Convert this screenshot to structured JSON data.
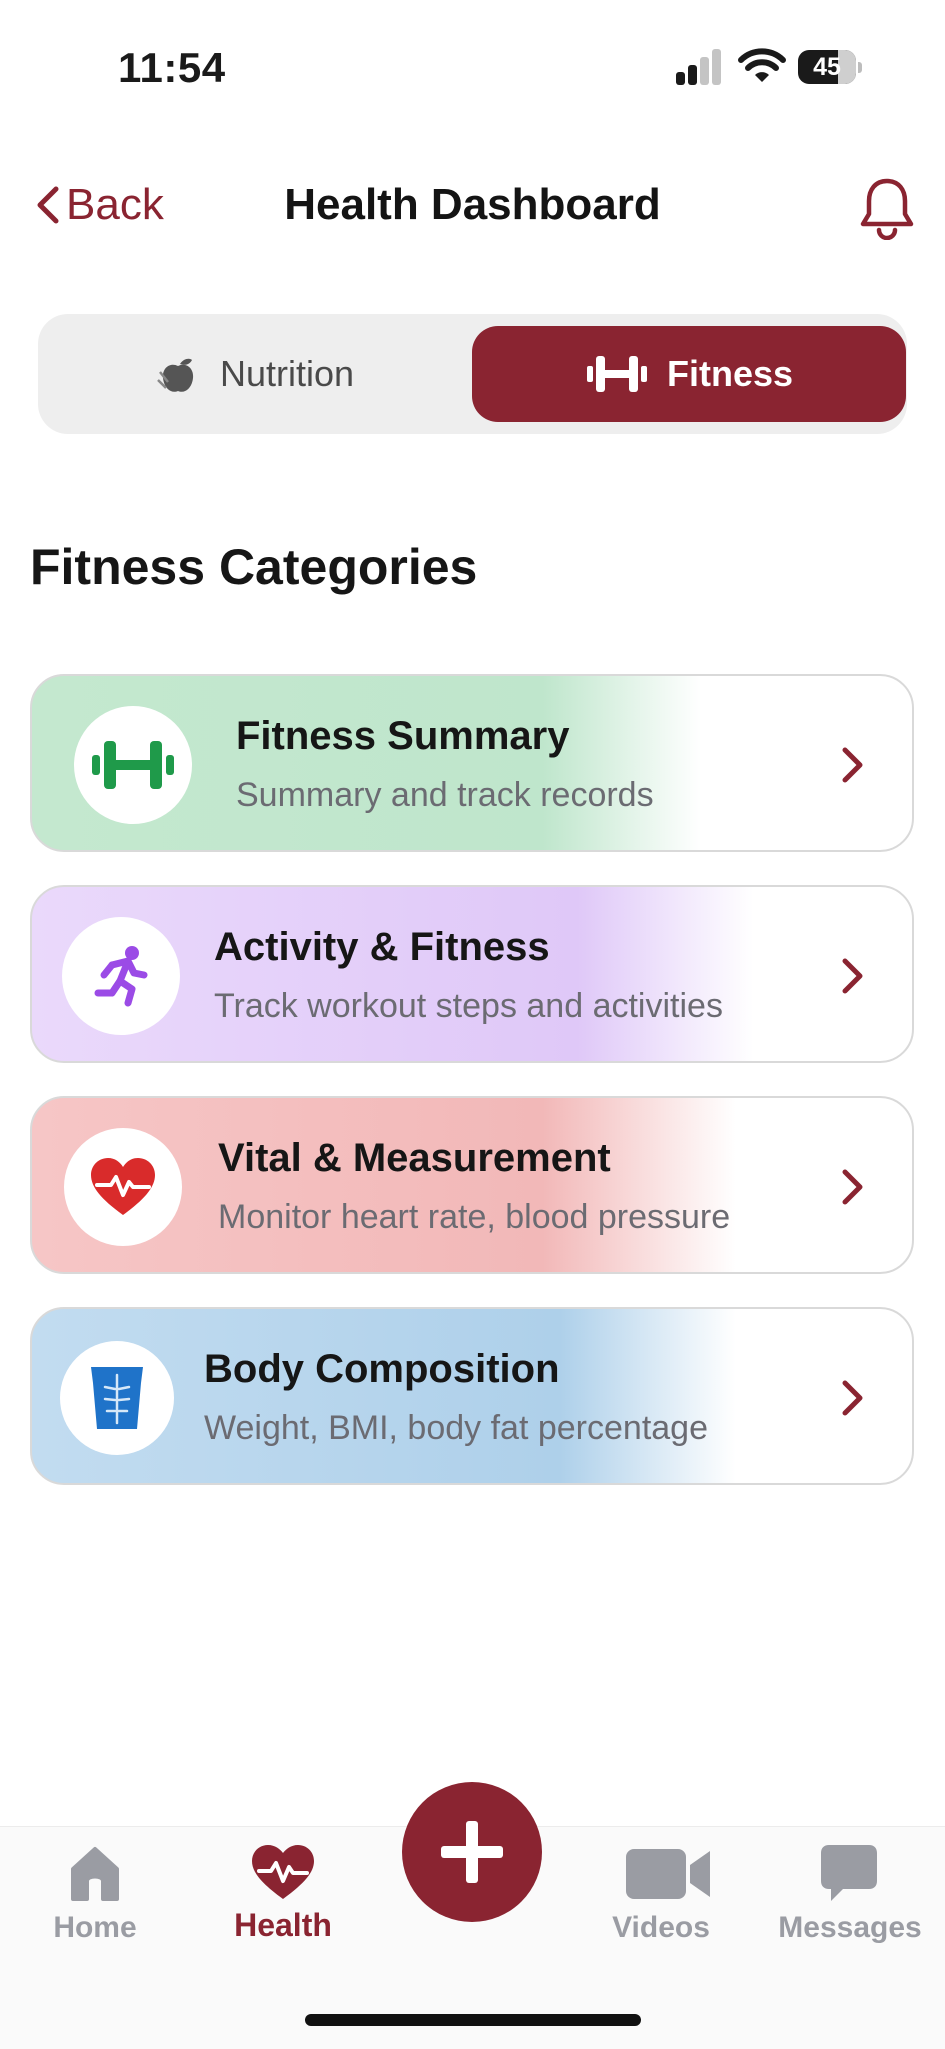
{
  "status_bar": {
    "time": "11:54",
    "battery": "45"
  },
  "header": {
    "back_label": "Back",
    "title": "Health Dashboard"
  },
  "segments": {
    "nutrition": "Nutrition",
    "fitness": "Fitness",
    "selected": "Fitness"
  },
  "section_title": "Fitness Categories",
  "cards": [
    {
      "title": "Fitness Summary",
      "subtitle": "Summary and track records",
      "icon": "dumbbell-icon",
      "tint": "#bfe6cc"
    },
    {
      "title": "Activity & Fitness",
      "subtitle": "Track workout steps and activities",
      "icon": "running-person-icon",
      "tint": "#e2ccf9"
    },
    {
      "title": "Vital & Measurement",
      "subtitle": "Monitor heart rate, blood pressure",
      "icon": "heartbeat-icon",
      "tint": "#f2b8b8"
    },
    {
      "title": "Body Composition",
      "subtitle": "Weight, BMI, body fat percentage",
      "icon": "torso-icon",
      "tint": "#aed0ea"
    }
  ],
  "tabbar": {
    "home": "Home",
    "health": "Health",
    "videos": "Videos",
    "messages": "Messages",
    "active": "Health"
  },
  "colors": {
    "brand": "#8a2431",
    "inactive": "#9a9ca3"
  }
}
